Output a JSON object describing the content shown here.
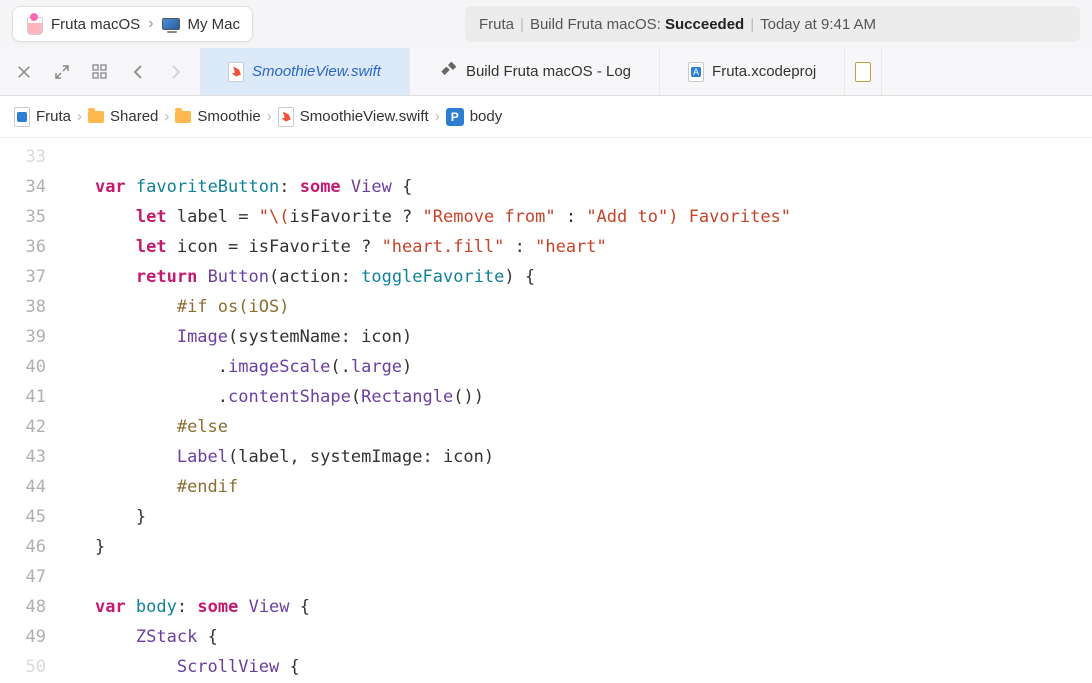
{
  "toolbar": {
    "scheme": "Fruta macOS",
    "target": "My Mac",
    "status_app": "Fruta",
    "status_build": "Build Fruta macOS:",
    "status_result": "Succeeded",
    "status_time": "Today at 9:41 AM"
  },
  "tabs": {
    "active": "SmoothieView.swift",
    "build_log": "Build Fruta macOS - Log",
    "project": "Fruta.xcodeproj"
  },
  "breadcrumb": {
    "root": "Fruta",
    "folder1": "Shared",
    "folder2": "Smoothie",
    "file": "SmoothieView.swift",
    "symbol": "body"
  },
  "code": {
    "lines": [
      {
        "n": "33",
        "partial": true,
        "html": ""
      },
      {
        "n": "34",
        "html": "    <span class='kw-decl'>var</span> <span class='ident-teal'>favoriteButton</span><span class='normal'>:</span> <span class='kw-decl'>some</span> <span class='kw-type'>View</span> <span class='normal'>{</span>"
      },
      {
        "n": "35",
        "html": "        <span class='kw-decl'>let</span> <span class='normal'>label = </span><span class='string'>\"\\(</span><span class='normal'>isFavorite ? </span><span class='string'>\"Remove from\"</span><span class='normal'> : </span><span class='string'>\"Add to\"</span><span class='string'>)</span><span class='string'> Favorites\"</span>"
      },
      {
        "n": "36",
        "html": "        <span class='kw-decl'>let</span> <span class='normal'>icon = isFavorite ? </span><span class='string'>\"heart.fill\"</span><span class='normal'> : </span><span class='string'>\"heart\"</span>"
      },
      {
        "n": "37",
        "html": "        <span class='kw-decl'>return</span> <span class='ident-type'>Button</span><span class='normal'>(action: </span><span class='ident-teal'>toggleFavorite</span><span class='normal'>) {</span>"
      },
      {
        "n": "38",
        "html": "            <span class='directive'>#if os(iOS)</span>"
      },
      {
        "n": "39",
        "html": "            <span class='ident-type'>Image</span><span class='normal'>(systemName: icon)</span>"
      },
      {
        "n": "40",
        "html": "                <span class='normal'>.</span><span class='ident-type'>imageScale</span><span class='normal'>(.</span><span class='ident-type'>large</span><span class='normal'>)</span>"
      },
      {
        "n": "41",
        "html": "                <span class='normal'>.</span><span class='ident-type'>contentShape</span><span class='normal'>(</span><span class='ident-type'>Rectangle</span><span class='normal'>())</span>"
      },
      {
        "n": "42",
        "html": "            <span class='directive'>#else</span>"
      },
      {
        "n": "43",
        "html": "            <span class='ident-type'>Label</span><span class='normal'>(label, systemImage: icon)</span>"
      },
      {
        "n": "44",
        "html": "            <span class='directive'>#endif</span>"
      },
      {
        "n": "45",
        "html": "        <span class='normal'>}</span>"
      },
      {
        "n": "46",
        "html": "    <span class='normal'>}</span>"
      },
      {
        "n": "47",
        "html": ""
      },
      {
        "n": "48",
        "html": "    <span class='kw-decl'>var</span> <span class='ident-teal'>body</span><span class='normal'>:</span> <span class='kw-decl'>some</span> <span class='kw-type'>View</span> <span class='normal'>{</span>"
      },
      {
        "n": "49",
        "html": "        <span class='ident-type'>ZStack</span> <span class='normal'>{</span>"
      },
      {
        "n": "50",
        "partial": true,
        "html": "            <span class='ident-type'>ScrollView</span> <span class='normal'>{</span>"
      }
    ]
  }
}
